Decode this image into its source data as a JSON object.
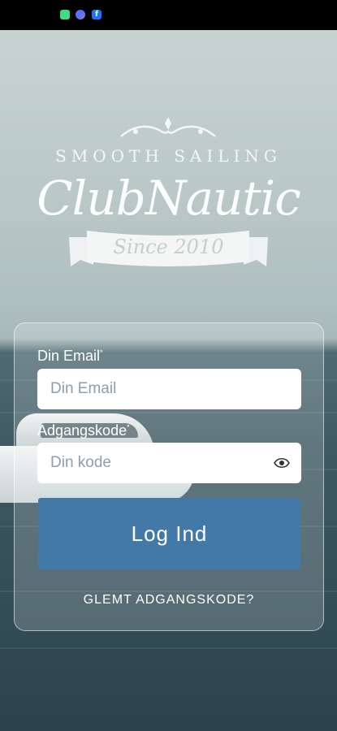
{
  "status_bar": {
    "icons": [
      "sms-icon",
      "messenger-icon",
      "facebook-icon"
    ],
    "facebook_glyph": "f"
  },
  "logo": {
    "tagline": "SMOOTH SAILING",
    "brand": "ClubNautic",
    "since": "Since 2010"
  },
  "form": {
    "email_label": "Din Email",
    "email_placeholder": "Din Email",
    "email_value": "",
    "password_label": "Adgangskode",
    "password_placeholder": "Din kode",
    "password_value": "",
    "required_marker": "*",
    "login_button": "Log Ind",
    "forgot_link": "GLEMT ADGANGSKODE?"
  },
  "colors": {
    "button": "#4379a7",
    "status_bar": "#000000"
  }
}
